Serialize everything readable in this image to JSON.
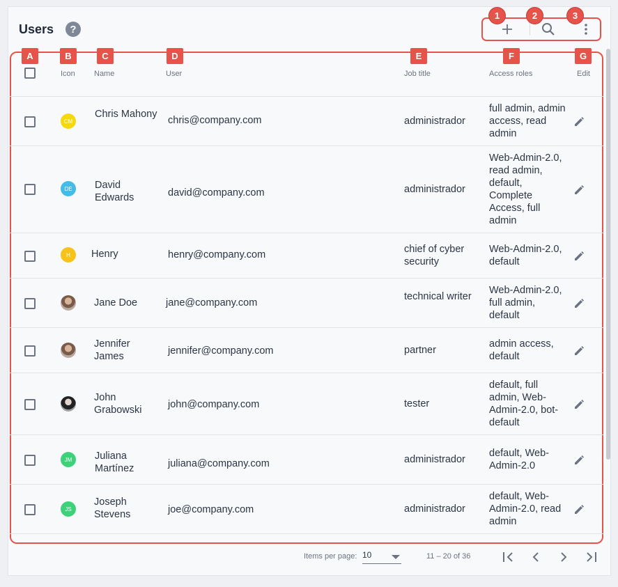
{
  "header": {
    "title": "Users",
    "help_icon": "question-circle-icon"
  },
  "toolbar": {
    "add_icon": "plus-icon",
    "search_icon": "search-icon",
    "more_icon": "more-vert-icon",
    "badges": [
      "1",
      "2",
      "3"
    ]
  },
  "column_markers": [
    "A",
    "B",
    "C",
    "D",
    "E",
    "F",
    "G"
  ],
  "table": {
    "columns": {
      "icon": "Icon",
      "name": "Name",
      "user": "User",
      "job": "Job title",
      "roles": "Access roles",
      "edit": "Edit"
    },
    "rows": [
      {
        "initials": "CM",
        "avatar_color": "#f5d90a",
        "name": "Chris Mahony",
        "email": "chris@company.com",
        "job": "administrador",
        "roles": "full admin, admin access, read admin"
      },
      {
        "initials": "DE",
        "avatar_color": "#42bde8",
        "name": "David Edwards",
        "email": "david@company.com",
        "job": "administrador",
        "roles": "Web-Admin-2.0, read admin, default, Complete Access, full admin"
      },
      {
        "initials": "H",
        "avatar_color": "#f7c21a",
        "name": "Henry",
        "email": "henry@company.com",
        "job": "chief of cyber security",
        "roles": "Web-Admin-2.0, default"
      },
      {
        "initials": "",
        "avatar_color": "photo",
        "name": "Jane Doe",
        "email": "jane@company.com",
        "job": "technical writer",
        "roles": "Web-Admin-2.0, full admin, default"
      },
      {
        "initials": "",
        "avatar_color": "photo",
        "name": "Jennifer James",
        "email": "jennifer@company.com",
        "job": "partner",
        "roles": "admin access, default"
      },
      {
        "initials": "",
        "avatar_color": "photo",
        "name": "John Grabowski",
        "email": "john@company.com",
        "job": "tester",
        "roles": "default, full admin, Web-Admin-2.0, bot-default"
      },
      {
        "initials": "JM",
        "avatar_color": "#3dd27a",
        "name": "Juliana Martínez",
        "email": "juliana@company.com",
        "job": "administrador",
        "roles": "default, Web-Admin-2.0"
      },
      {
        "initials": "JS",
        "avatar_color": "#3dd27a",
        "name": "Joseph Stevens",
        "email": "joe@company.com",
        "job": "administrador",
        "roles": "default, Web-Admin-2.0, read admin"
      }
    ]
  },
  "pagination": {
    "items_per_page_label": "Items per page:",
    "items_per_page_value": "10",
    "range": "11 – 20 of 36"
  },
  "colors": {
    "annotation": "#e5534b"
  }
}
